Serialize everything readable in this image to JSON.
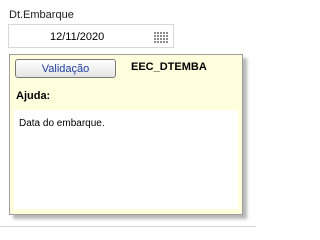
{
  "field": {
    "label": "Dt.Embarque",
    "value": "12/11/2020",
    "calendar_icon": "calendar-icon"
  },
  "help_panel": {
    "validation_button_label": "Validação",
    "field_code": "EEC_DTEMBA",
    "help_heading": "Ajuda:",
    "help_text": "Data do embarque."
  },
  "colors": {
    "panel_background": "#ffffdd",
    "button_text": "#1f3fa0"
  }
}
